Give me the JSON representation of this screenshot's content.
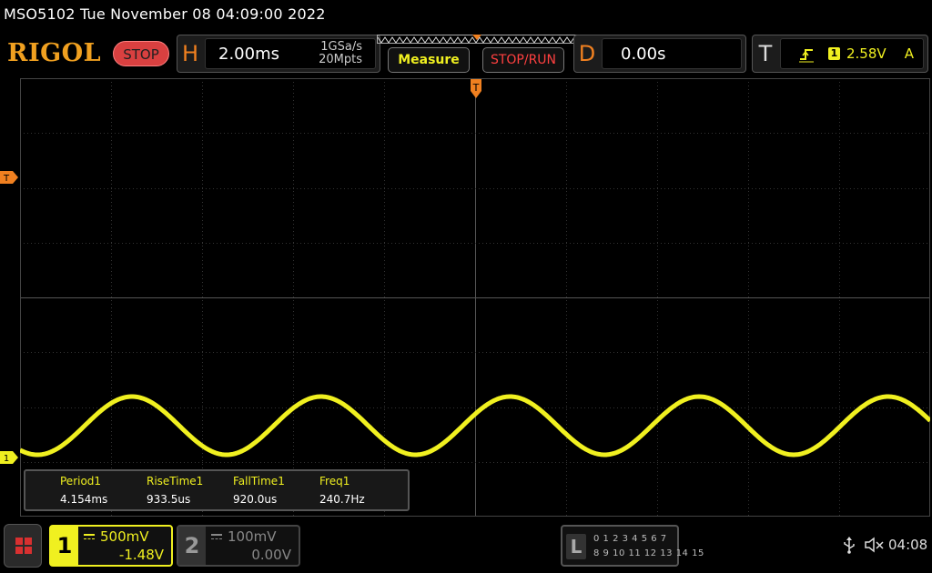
{
  "window": {
    "title": "MSO5102  Tue November 08 04:09:00 2022"
  },
  "brand": {
    "logo": "RIGOL",
    "run_state": "STOP"
  },
  "horizontal": {
    "letter": "H",
    "timebase": "2.00ms",
    "sample_rate": "1GSa/s",
    "memory_depth": "20Mpts"
  },
  "buttons": {
    "measure": "Measure",
    "stop_run": "STOP/RUN"
  },
  "delay": {
    "letter": "D",
    "value": "0.00s"
  },
  "trigger": {
    "letter": "T",
    "slope_icon": "rising-edge-icon",
    "source": "1",
    "level": "2.58V",
    "mode": "A"
  },
  "markers": {
    "trigger_position": "T",
    "trigger_level": "T",
    "channel1": "1"
  },
  "measurements": [
    {
      "name": "Period1",
      "value": "4.154ms"
    },
    {
      "name": "RiseTime1",
      "value": "933.5us"
    },
    {
      "name": "FallTime1",
      "value": "920.0us"
    },
    {
      "name": "Freq1",
      "value": "240.7Hz"
    }
  ],
  "channel1": {
    "number": "1",
    "scale": "500mV",
    "offset": "-1.48V",
    "color": "#f0f020",
    "enabled": true
  },
  "channel2": {
    "number": "2",
    "scale": "100mV",
    "offset": "0.00V",
    "color": "#888888",
    "enabled": false
  },
  "logic": {
    "letter": "L",
    "row1": "0 1 2 3   4 5 6 7",
    "row2": "8  9 10 11  12 13 14 15"
  },
  "status": {
    "time": "04:08",
    "usb_icon": "usb-icon",
    "sound_icon": "speaker-muted-icon"
  },
  "waveform": {
    "channel": "1",
    "frequency_hz": 240.7,
    "period_ms": 4.154,
    "shape": "sine"
  },
  "colors": {
    "accent_orange": "#f08020",
    "ch1_yellow": "#f0f020",
    "stop_red": "#d94040"
  }
}
